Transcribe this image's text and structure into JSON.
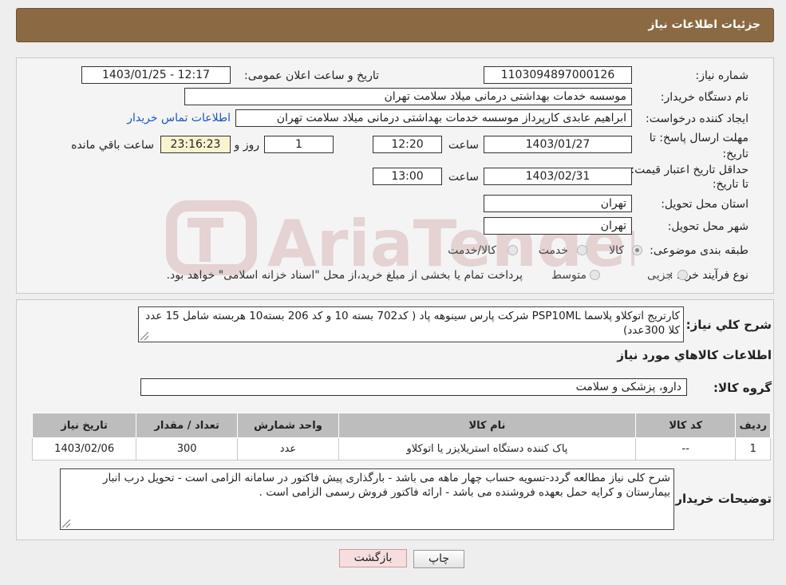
{
  "header": {
    "title": "جزئیات اطلاعات نیاز"
  },
  "labels": {
    "need_number": "شماره نیاز:",
    "announce_datetime": "تاریخ و ساعت اعلان عمومی:",
    "buyer_org": "نام دستگاه خریدار:",
    "requester": "ایجاد کننده درخواست:",
    "reply_deadline": "مهلت ارسال پاسخ: تا تاریخ:",
    "price_validity": "حداقل تاریخ اعتبار قیمت: تا تاریخ:",
    "time": "ساعت",
    "day_and": "روز و",
    "remaining": "ساعت باقي مانده",
    "province": "استان محل تحویل:",
    "city": "شهر محل تحویل:",
    "category": "طبقه بندی موضوعی:",
    "process_type": "نوع فرآیند خرید :",
    "general_desc": "شرح کلي نياز:",
    "goods_info": "اطلاعات کالاهاي مورد نياز",
    "goods_group": "گروه کالا:",
    "buyer_notes": "توضیحات خریدار:"
  },
  "values": {
    "need_number": "1103094897000126",
    "announce_datetime": "1403/01/25 - 12:17",
    "buyer_org": "موسسه خدمات بهداشتی درمانی میلاد سلامت تهران",
    "requester": "ابراهیم عابدی کارپرداز موسسه خدمات بهداشتی درمانی میلاد سلامت تهران",
    "contact_link": "اطلاعات تماس خریدار",
    "reply_date": "1403/01/27",
    "reply_time": "12:20",
    "days": "1",
    "countdown": "23:16:23",
    "validity_date": "1403/02/31",
    "validity_time": "13:00",
    "province": "تهران",
    "city": "تهران"
  },
  "category_options": [
    {
      "label": "کالا",
      "selected": true
    },
    {
      "label": "خدمت",
      "selected": false
    },
    {
      "label": "کالا/خدمت",
      "selected": false
    }
  ],
  "process_options": [
    {
      "label": "جزیی",
      "selected": false
    },
    {
      "label": "متوسط",
      "selected": false
    }
  ],
  "process_note": "پرداخت تمام یا بخشی از مبلغ خرید،از محل \"اسناد خزانه اسلامی\" خواهد بود.",
  "general_description": "کارتریج اتوکلاو پلاسما PSP10ML شرکت پارس سینوهه پاد ( کد702 بسته 10 و کد 206 بسته10 هربسته شامل 15 عدد کلا 300عدد)",
  "goods_group": "دارو، پزشکی و سلامت",
  "table": {
    "headers": [
      "ردیف",
      "کد کالا",
      "نام کالا",
      "واحد شمارش",
      "تعداد / مقدار",
      "تاریخ نیاز"
    ],
    "rows": [
      [
        "1",
        "--",
        "پاک کننده دستگاه استریلایزر یا اتوکلاو",
        "عدد",
        "300",
        "1403/02/06"
      ]
    ]
  },
  "buyer_notes": "شرح کلی نیاز مطالعه گردد-تسویه حساب چهار ماهه می باشد - بارگذاری پیش فاکتور در سامانه الزامی است - تحویل درب انبار بیمارستان و کرایه حمل بعهده فروشنده می باشد - ارائه فاکتور فروش رسمی الزامی است .",
  "buttons": {
    "print": "چاپ",
    "back": "بازگشت"
  },
  "watermark": "AriaTender.neT"
}
